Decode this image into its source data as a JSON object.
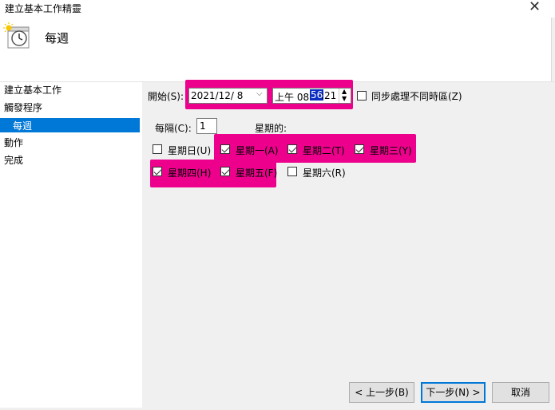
{
  "window": {
    "title": "建立基本工作精靈",
    "close_glyph": "✕"
  },
  "header": {
    "title": "每週",
    "icon": "calendar-clock-icon"
  },
  "nav": {
    "items": [
      "建立基本工作",
      "觸發程序",
      "每週",
      "動作",
      "完成"
    ],
    "selected_index": 2
  },
  "start": {
    "label": "開始(S):",
    "date": "2021/12/  8",
    "time_prefix": "上午 08:",
    "time_selected": "56",
    "time_suffix": ":21",
    "sync_label": "同步處理不同時區(Z)",
    "sync_checked": false
  },
  "recur": {
    "label": "每隔(C):",
    "value": "1",
    "weeks_label": "星期的:"
  },
  "days": [
    {
      "label": "星期日(U)",
      "checked": false
    },
    {
      "label": "星期一(A)",
      "checked": true
    },
    {
      "label": "星期二(T)",
      "checked": true
    },
    {
      "label": "星期三(Y)",
      "checked": true
    },
    {
      "label": "星期四(H)",
      "checked": true
    },
    {
      "label": "星期五(F)",
      "checked": true
    },
    {
      "label": "星期六(R)",
      "checked": false
    }
  ],
  "buttons": {
    "back": "< 上一步(B)",
    "next": "下一步(N) >",
    "cancel": "取消"
  },
  "colors": {
    "highlight": "#ec008c",
    "selection": "#0078d7",
    "panel": "#f0f0f0"
  }
}
